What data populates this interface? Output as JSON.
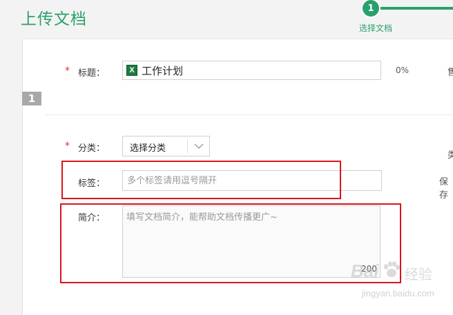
{
  "header": {
    "title": "上传文档"
  },
  "stepper": {
    "step_number": "1",
    "step_label": "选择文档"
  },
  "file": {
    "index": "1"
  },
  "form": {
    "required_mark": "*",
    "title": {
      "label": "标题：",
      "value": "工作计划",
      "file_icon_letter": "X",
      "progress": "0%"
    },
    "category": {
      "label": "分类：",
      "selected": "选择分类"
    },
    "tags": {
      "label": "标签：",
      "placeholder": "多个标签请用逗号隔开"
    },
    "intro": {
      "label": "简介：",
      "placeholder": "填写文档简介，能帮助文档传播更广~",
      "char_limit": "200"
    }
  },
  "right_column_partials": {
    "row1": "售",
    "row2": "类",
    "row3": "保存"
  },
  "watermark": {
    "brand": "Bai",
    "brand_cn": "经验",
    "url": "jingyan.baidu.com"
  },
  "colors": {
    "accent": "#2aa06b",
    "required": "#e02c2c",
    "highlight": "#d9141b",
    "excel": "#1d7a41"
  }
}
